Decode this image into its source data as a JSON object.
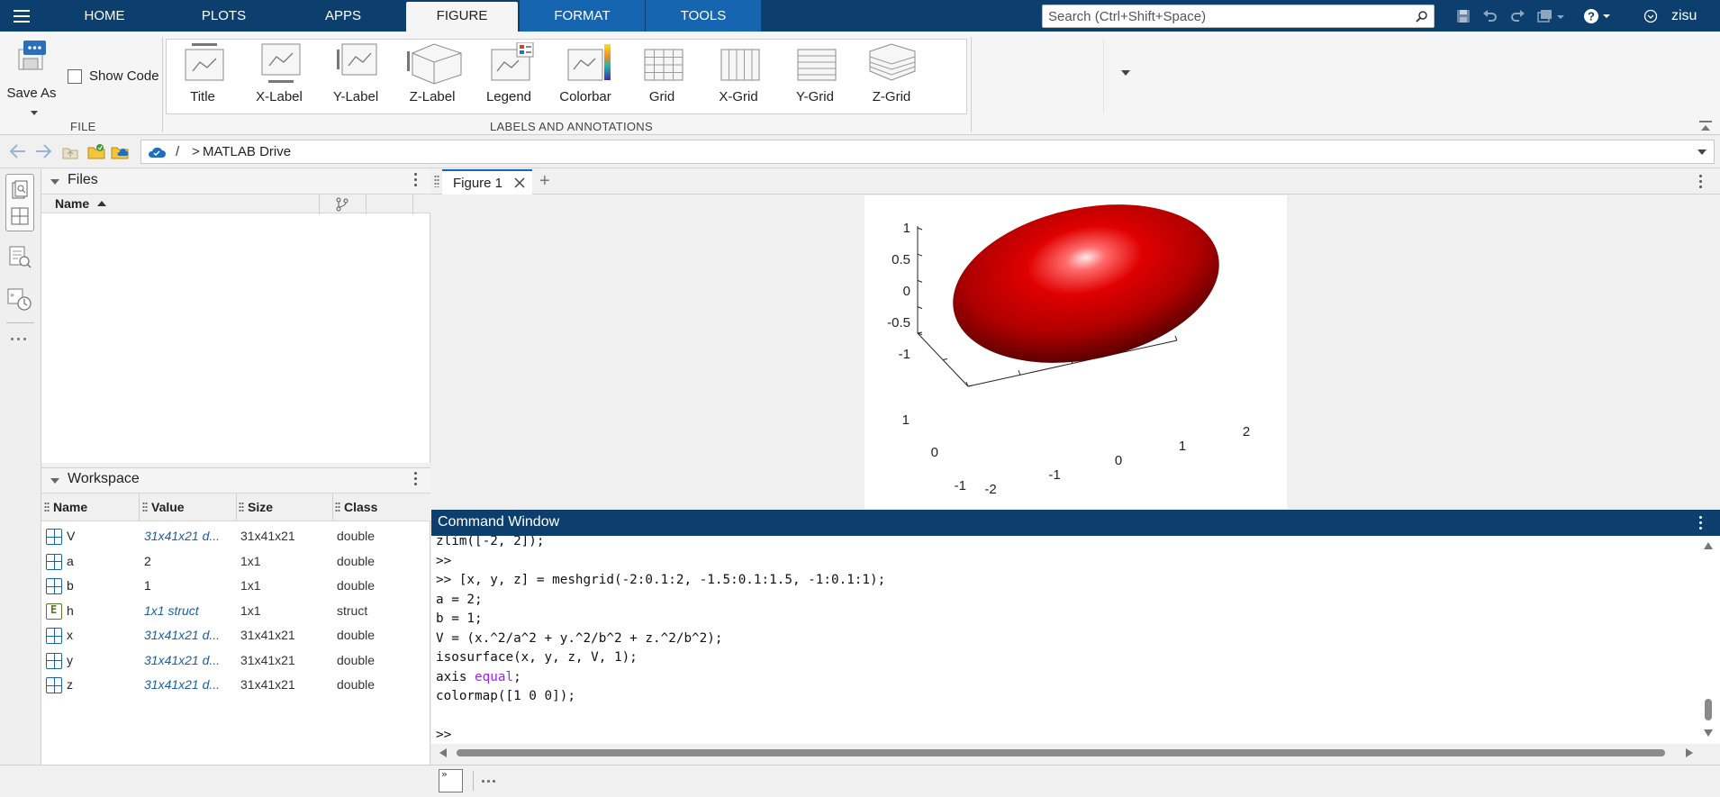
{
  "topbar": {
    "tabs": [
      {
        "label": "HOME",
        "state": "normal"
      },
      {
        "label": "PLOTS",
        "state": "normal"
      },
      {
        "label": "APPS",
        "state": "normal"
      },
      {
        "label": "FIGURE",
        "state": "active"
      },
      {
        "label": "FORMAT",
        "state": "normal"
      },
      {
        "label": "TOOLS",
        "state": "normal"
      }
    ],
    "search_placeholder": "Search (Ctrl+Shift+Space)",
    "user": "zisu",
    "colors": {
      "bar": "#0c3f6e",
      "figure_tabs": "#1565b0"
    }
  },
  "ribbon": {
    "file": {
      "save_as": "Save As",
      "show_code": "Show Code",
      "show_code_checked": false,
      "section_label": "FILE"
    },
    "annotations": {
      "section_label": "LABELS AND ANNOTATIONS",
      "items": [
        "Title",
        "X-Label",
        "Y-Label",
        "Z-Label",
        "Legend",
        "Colorbar",
        "Grid",
        "X-Grid",
        "Y-Grid",
        "Z-Grid"
      ]
    }
  },
  "address": {
    "root": "/",
    "separator": ">",
    "folder": "MATLAB Drive"
  },
  "files": {
    "title": "Files",
    "col_name": "Name"
  },
  "workspace": {
    "title": "Workspace",
    "columns": [
      "Name",
      "Value",
      "Size",
      "Class"
    ],
    "rows": [
      {
        "icon": "matrix-icon",
        "name": "V",
        "value": "31x41x21 d...",
        "value_link": true,
        "size": "31x41x21",
        "class": "double"
      },
      {
        "icon": "matrix-icon",
        "name": "a",
        "value": "2",
        "value_link": false,
        "size": "1x1",
        "class": "double"
      },
      {
        "icon": "matrix-icon",
        "name": "b",
        "value": "1",
        "value_link": false,
        "size": "1x1",
        "class": "double"
      },
      {
        "icon": "struct-icon",
        "name": "h",
        "value": "1x1 struct",
        "value_link": true,
        "size": "1x1",
        "class": "struct"
      },
      {
        "icon": "matrix-icon",
        "name": "x",
        "value": "31x41x21 d...",
        "value_link": true,
        "size": "31x41x21",
        "class": "double"
      },
      {
        "icon": "matrix-icon",
        "name": "y",
        "value": "31x41x21 d...",
        "value_link": true,
        "size": "31x41x21",
        "class": "double"
      },
      {
        "icon": "matrix-icon",
        "name": "z",
        "value": "31x41x21 d...",
        "value_link": true,
        "size": "31x41x21",
        "class": "double"
      }
    ]
  },
  "figure": {
    "tab_label": "Figure 1",
    "plot": {
      "type": "3d-isosurface-ellipsoid",
      "surface_color": "#d10000",
      "z_ticks": [
        "1",
        "0.5",
        "0",
        "-0.5",
        "-1"
      ],
      "y_ticks": [
        "1",
        "0",
        "-1"
      ],
      "x_ticks": [
        "-2",
        "-1",
        "0",
        "1",
        "2"
      ]
    }
  },
  "command_window": {
    "title": "Command Window",
    "lines": [
      "zlim([-2, 2]);",
      ">>",
      ">> [x, y, z] = meshgrid(-2:0.1:2, -1.5:0.1:1.5, -1:0.1:1);",
      "a = 2;",
      "b = 1;",
      "V = (x.^2/a^2 + y.^2/b^2 + z.^2/b^2);",
      "isosurface(x, y, z, V, 1);",
      "axis [[equal]];",
      "colormap([1 0 0]);",
      "",
      ">>"
    ]
  }
}
